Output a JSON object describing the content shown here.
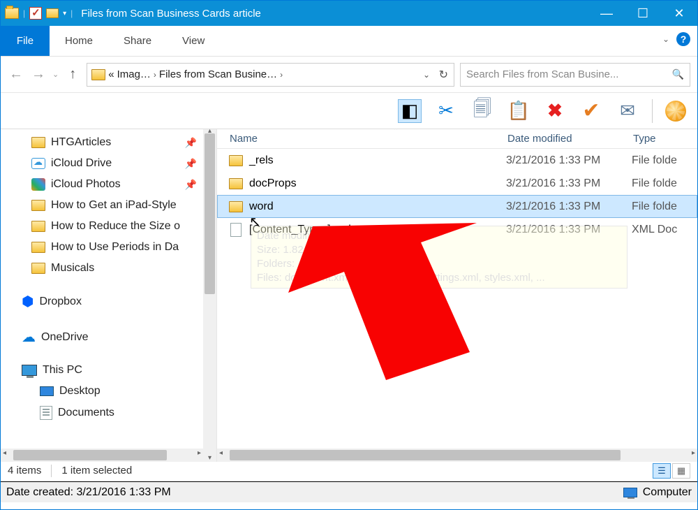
{
  "window": {
    "title": "Files from Scan Business Cards article"
  },
  "ribbon": {
    "file": "File",
    "home": "Home",
    "share": "Share",
    "view": "View"
  },
  "breadcrumb": {
    "first": "Imag…",
    "second": "Files from Scan Busine…"
  },
  "search": {
    "placeholder": "Search Files from Scan Busine..."
  },
  "tree": {
    "items": [
      {
        "label": "HTGArticles",
        "pinned": true,
        "icon": "folder"
      },
      {
        "label": "iCloud Drive",
        "pinned": true,
        "icon": "cloud"
      },
      {
        "label": "iCloud Photos",
        "pinned": true,
        "icon": "photos"
      },
      {
        "label": "How to Get an iPad-Style",
        "icon": "folder"
      },
      {
        "label": "How to Reduce the Size o",
        "icon": "folder"
      },
      {
        "label": "How to Use Periods in Da",
        "icon": "folder"
      },
      {
        "label": "Musicals",
        "icon": "folder"
      }
    ],
    "dropbox": "Dropbox",
    "onedrive": "OneDrive",
    "thispc": "This PC",
    "desktop": "Desktop",
    "documents": "Documents"
  },
  "columns": {
    "name": "Name",
    "date": "Date modified",
    "type": "Type"
  },
  "files": [
    {
      "name": "_rels",
      "date": "3/21/2016 1:33 PM",
      "type": "File folde",
      "kind": "folder"
    },
    {
      "name": "docProps",
      "date": "3/21/2016 1:33 PM",
      "type": "File folde",
      "kind": "folder"
    },
    {
      "name": "word",
      "date": "3/21/2016 1:33 PM",
      "type": "File folde",
      "kind": "folder",
      "selected": true
    },
    {
      "name": "[Content_Types].xml",
      "date": "3/21/2016 1:33 PM",
      "type": "XML Doc",
      "kind": "xml"
    }
  ],
  "tooltip": {
    "line1": "Date modified: 3/21/2016 1:33 PM",
    "line2": "Size: 1.82 MB",
    "line3": "Folders: _rels, media, theme",
    "line4": "Files: document.xml, fontTable.xml, settings.xml, styles.xml, ..."
  },
  "status": {
    "items": "4 items",
    "selected": "1 item selected"
  },
  "footer": {
    "date": "Date created: 3/21/2016 1:33 PM",
    "computer": "Computer"
  }
}
